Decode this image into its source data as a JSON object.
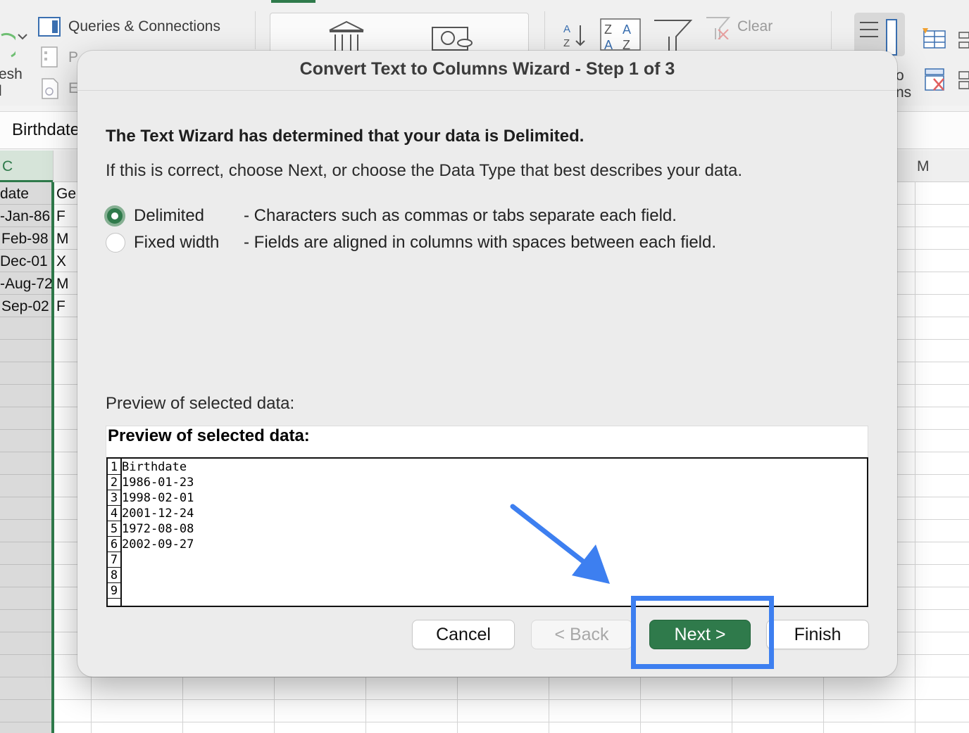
{
  "ribbon": {
    "queries_connections": "Queries & Connections",
    "refresh_fragment": "esh",
    "refresh_fragment2": "l",
    "truncated_p": "P",
    "truncated_e": "E",
    "clear_label": "Clear",
    "right_fragment1": "o",
    "right_fragment2": "ns"
  },
  "formula_bar": {
    "value": "Birthdate"
  },
  "columns": {
    "c": "C",
    "m": "M"
  },
  "sheet": {
    "rows": [
      {
        "c": "date",
        "d": "Ge"
      },
      {
        "c": "-Jan-86",
        "d": "F"
      },
      {
        "c": "Feb-98",
        "d": "M"
      },
      {
        "c": "Dec-01",
        "d": "X"
      },
      {
        "c": "-Aug-72",
        "d": "M"
      },
      {
        "c": "Sep-02",
        "d": "F"
      }
    ]
  },
  "dialog": {
    "title": "Convert Text to Columns Wizard - Step 1 of 3",
    "heading": "The Text Wizard has determined that your data is Delimited.",
    "instruction": "If this is correct, choose Next, or choose the Data Type that best describes your data.",
    "options": [
      {
        "label": "Delimited",
        "description": "- Characters such as commas or tabs separate each field.",
        "selected": true
      },
      {
        "label": "Fixed width",
        "description": "- Fields are aligned in columns with spaces between each field.",
        "selected": false
      }
    ],
    "preview_label": "Preview of selected data:",
    "preview_header": "Preview of selected data:",
    "preview_rows": [
      {
        "num": "1",
        "value": "Birthdate"
      },
      {
        "num": "2",
        "value": "1986-01-23"
      },
      {
        "num": "3",
        "value": "1998-02-01"
      },
      {
        "num": "4",
        "value": "2001-12-24"
      },
      {
        "num": "5",
        "value": "1972-08-08"
      },
      {
        "num": "6",
        "value": "2002-09-27"
      },
      {
        "num": "7",
        "value": ""
      },
      {
        "num": "8",
        "value": ""
      },
      {
        "num": "9",
        "value": ""
      }
    ],
    "buttons": {
      "cancel": "Cancel",
      "back": "< Back",
      "next": "Next >",
      "finish": "Finish"
    }
  },
  "colors": {
    "excel_green": "#2f7a4b",
    "annotation_blue": "#3d7ff0"
  }
}
